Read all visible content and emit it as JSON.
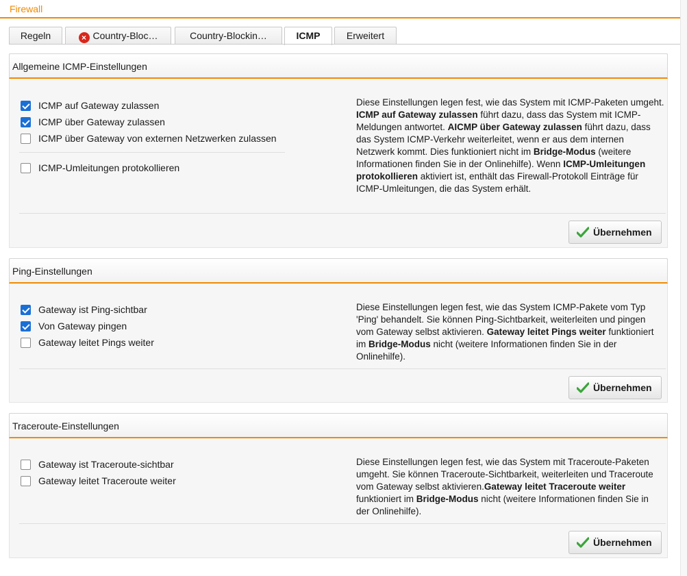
{
  "header": {
    "title": "Firewall"
  },
  "tabs": [
    {
      "label": "Regeln",
      "active": false,
      "error": false
    },
    {
      "label": "Country-Bloc…",
      "active": false,
      "error": true
    },
    {
      "label": "Country-Blockin…",
      "active": false,
      "error": false
    },
    {
      "label": "ICMP",
      "active": true,
      "error": false
    },
    {
      "label": "Erweitert",
      "active": false,
      "error": false
    }
  ],
  "icmp": {
    "title": "Allgemeine ICMP-Einstellungen",
    "options": [
      {
        "label": "ICMP auf Gateway zulassen",
        "checked": true
      },
      {
        "label": "ICMP über Gateway zulassen",
        "checked": true
      },
      {
        "label": "ICMP über Gateway von externen Netzwerken zulassen",
        "checked": false
      },
      {
        "label": "ICMP-Umleitungen protokollieren",
        "checked": false
      }
    ],
    "desc": [
      "Diese Einstellungen legen fest, wie das System mit ICMP-Paketen umgeht. ",
      "ICMP auf Gateway zulassen",
      " führt dazu, dass das System mit ICMP-Meldungen antwortet. ",
      "AICMP über Gateway zulassen",
      " führt dazu, dass das System ICMP-Verkehr weiterleitet, wenn er aus dem internen Netzwerk kommt. Dies funktioniert nicht im ",
      "Bridge-Modus",
      " (weitere Informationen finden Sie in der Onlinehilfe). Wenn ",
      "ICMP-Umleitungen protokollieren",
      " aktiviert ist, enthält das Firewall-Protokoll Einträge für ICMP-Umleitungen, die das System erhält."
    ],
    "apply_label": "Übernehmen"
  },
  "ping": {
    "title": "Ping-Einstellungen",
    "options": [
      {
        "label": "Gateway ist Ping-sichtbar",
        "checked": true
      },
      {
        "label": "Von Gateway pingen",
        "checked": true
      },
      {
        "label": "Gateway leitet Pings weiter",
        "checked": false
      }
    ],
    "desc": [
      "Diese Einstellungen legen fest, wie das System ICMP-Pakete vom Typ 'Ping' behandelt. Sie können Ping-Sichtbarkeit, weiterleiten und pingen vom Gateway selbst aktivieren. ",
      "Gateway leitet Pings weiter",
      " funktioniert im ",
      "Bridge-Modus",
      " nicht (weitere Informationen finden Sie in der Onlinehilfe)."
    ],
    "apply_label": "Übernehmen"
  },
  "traceroute": {
    "title": "Traceroute-Einstellungen",
    "options": [
      {
        "label": "Gateway ist Traceroute-sichtbar",
        "checked": false
      },
      {
        "label": "Gateway leitet Traceroute weiter",
        "checked": false
      }
    ],
    "desc": [
      "Diese Einstellungen legen fest, wie das System mit Traceroute-Paketen umgeht. Sie können Traceroute-Sichtbarkeit, weiterleiten und Traceroute vom Gateway selbst aktivieren.",
      "Gateway leitet Traceroute weiter",
      " funktioniert im ",
      "Bridge-Modus",
      " nicht (weitere Informationen finden Sie in der Onlinehilfe)."
    ],
    "apply_label": "Übernehmen"
  },
  "colors": {
    "accent": "#f08a00",
    "checkbox": "#1a6fd6",
    "error": "#d9261c",
    "check_green": "#3aa53a"
  },
  "icons": {
    "tab_error": "error-x-icon",
    "apply": "check-icon"
  }
}
